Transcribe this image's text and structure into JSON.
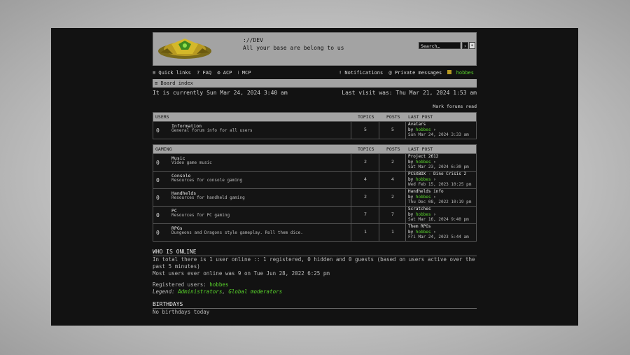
{
  "header": {
    "site_name": "://DEV",
    "site_desc": "All your base are belong to us",
    "search_placeholder": "Search…",
    "search_button": "›",
    "advanced_button": "*"
  },
  "navbar": {
    "quick_links": "≡ Quick links",
    "faq": "? FAQ",
    "acp": "⚙ ACP",
    "mcp": "⁞ MCP",
    "notifications": "! Notifications",
    "private_messages": "@ Private messages",
    "username": "hobbes"
  },
  "breadcrumb": "≡ Board index",
  "time": {
    "current": "It is currently Sun Mar 24, 2024 3:40 am",
    "last_visit": "Last visit was: Thu Mar 21, 2024 1:53 am"
  },
  "mark_forums_read": "Mark forums read",
  "columns": {
    "topics": "TOPICS",
    "posts": "POSTS",
    "last_post": "LAST POST"
  },
  "categories": [
    {
      "name": "USERS",
      "forums": [
        {
          "icon": "0",
          "title": "Information",
          "desc": "General forum info for all users",
          "topics": "5",
          "posts": "5",
          "last_title": "Avatars",
          "last_by": "by",
          "last_user": "hobbes",
          "last_time": "Sun Mar 24, 2024 3:33 am"
        }
      ]
    },
    {
      "name": "GAMING",
      "forums": [
        {
          "icon": "0",
          "title": "Music",
          "desc": "Video game music",
          "topics": "2",
          "posts": "2",
          "last_title": "Project 2612",
          "last_by": "by",
          "last_user": "hobbes",
          "last_time": "Sat Mar 23, 2024 6:30 pm"
        },
        {
          "icon": "0",
          "title": "Console",
          "desc": "Resources for console gaming",
          "topics": "4",
          "posts": "4",
          "last_title": "PCSXBOX - Dino Crisis 2",
          "last_by": "by",
          "last_user": "hobbes",
          "last_time": "Wed Feb 15, 2023 10:25 pm"
        },
        {
          "icon": "0",
          "title": "Handhelds",
          "desc": "Resources for handheld gaming",
          "topics": "2",
          "posts": "2",
          "last_title": "Handhelds info",
          "last_by": "by",
          "last_user": "hobbes",
          "last_time": "Thu Dec 08, 2022 10:19 pm"
        },
        {
          "icon": "0",
          "title": "PC",
          "desc": "Resources for PC gaming",
          "topics": "7",
          "posts": "7",
          "last_title": "Scratches",
          "last_by": "by",
          "last_user": "hobbes",
          "last_time": "Sat Mar 16, 2024 9:40 pm"
        },
        {
          "icon": "0",
          "title": "RPGs",
          "desc": "Dungeons and Dragons style gameplay. Roll them dice.",
          "topics": "1",
          "posts": "1",
          "last_title": "Them RPGs",
          "last_by": "by",
          "last_user": "hobbes",
          "last_time": "Fri Mar 24, 2023 5:44 am"
        }
      ]
    }
  ],
  "who_is_online": {
    "title": "WHO IS ONLINE",
    "line1": "In total there is 1 user online :: 1 registered, 0 hidden and 0 guests (based on users active over the past 5 minutes)",
    "line2": "Most users ever online was 9 on Tue Jun 28, 2022 6:25 pm",
    "registered_label": "Registered users:",
    "registered_user": "hobbes",
    "legend_label": "Legend:",
    "legend_admins": "Administrators",
    "legend_sep": ",",
    "legend_mods": "Global moderators"
  },
  "birthdays": {
    "title": "BIRTHDAYS",
    "text": "No birthdays today"
  },
  "colors": {
    "accent": "#59d62b",
    "header_bg": "#a3a3a3",
    "page_bg": "#121212"
  }
}
